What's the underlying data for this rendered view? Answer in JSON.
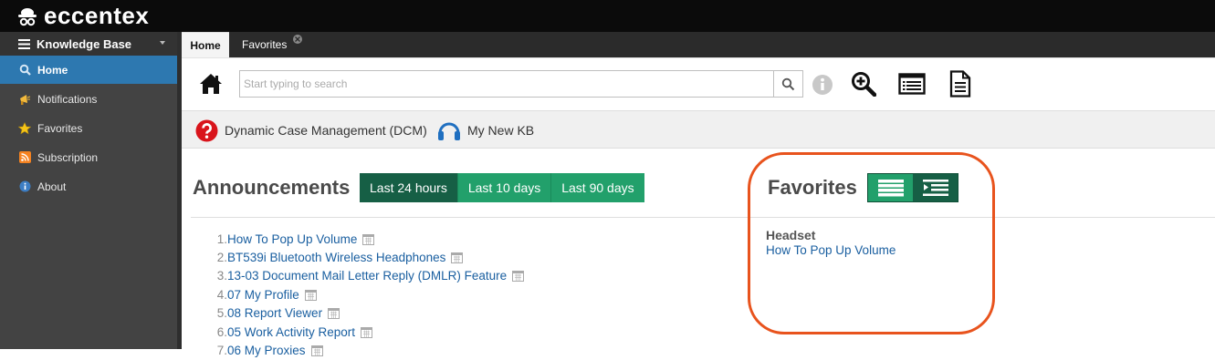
{
  "brand": {
    "name": "eccentex"
  },
  "sidebar": {
    "header": "Knowledge Base",
    "items": [
      {
        "label": "Home",
        "icon": "search-icon",
        "active": true
      },
      {
        "label": "Notifications",
        "icon": "megaphone-icon",
        "active": false
      },
      {
        "label": "Favorites",
        "icon": "star-icon",
        "active": false
      },
      {
        "label": "Subscription",
        "icon": "rss-icon",
        "active": false
      },
      {
        "label": "About",
        "icon": "info-icon",
        "active": false
      }
    ]
  },
  "tabs": [
    {
      "label": "Home",
      "active": true
    },
    {
      "label": "Favorites",
      "active": false,
      "closable": true
    }
  ],
  "toolbar": {
    "search_placeholder": "Start typing to search",
    "icons": [
      "home-icon",
      "search-icon",
      "info-icon",
      "zoom-in-icon",
      "list-view-icon",
      "document-icon"
    ]
  },
  "knowledge_bases": [
    {
      "label": "Dynamic Case Management (DCM)",
      "icon": "question-circle-icon",
      "color": "#d9141b"
    },
    {
      "label": "My New KB",
      "icon": "headset-icon",
      "color": "#1f6fc0"
    }
  ],
  "announcements": {
    "title": "Announcements",
    "filters": [
      {
        "label": "Last 24 hours",
        "active": true
      },
      {
        "label": "Last 10 days",
        "active": false
      },
      {
        "label": "Last 90 days",
        "active": false
      }
    ],
    "items": [
      {
        "num": "1.",
        "title": "How To Pop Up Volume"
      },
      {
        "num": "2.",
        "title": "BT539i Bluetooth Wireless Headphones"
      },
      {
        "num": "3.",
        "title": "13-03 Document Mail Letter Reply (DMLR) Feature"
      },
      {
        "num": "4.",
        "title": "07 My Profile"
      },
      {
        "num": "5.",
        "title": "08 Report Viewer"
      },
      {
        "num": "6.",
        "title": "05 Work Activity Report"
      },
      {
        "num": "7.",
        "title": "06 My Proxies"
      }
    ]
  },
  "favorites": {
    "title": "Favorites",
    "group": "Headset",
    "items": [
      "How To Pop Up Volume"
    ]
  },
  "colors": {
    "accent_blue": "#2d78b0",
    "filter_green": "#22a06b",
    "filter_active": "#165f45",
    "highlight": "#e8531d",
    "link": "#1a5fa0"
  }
}
